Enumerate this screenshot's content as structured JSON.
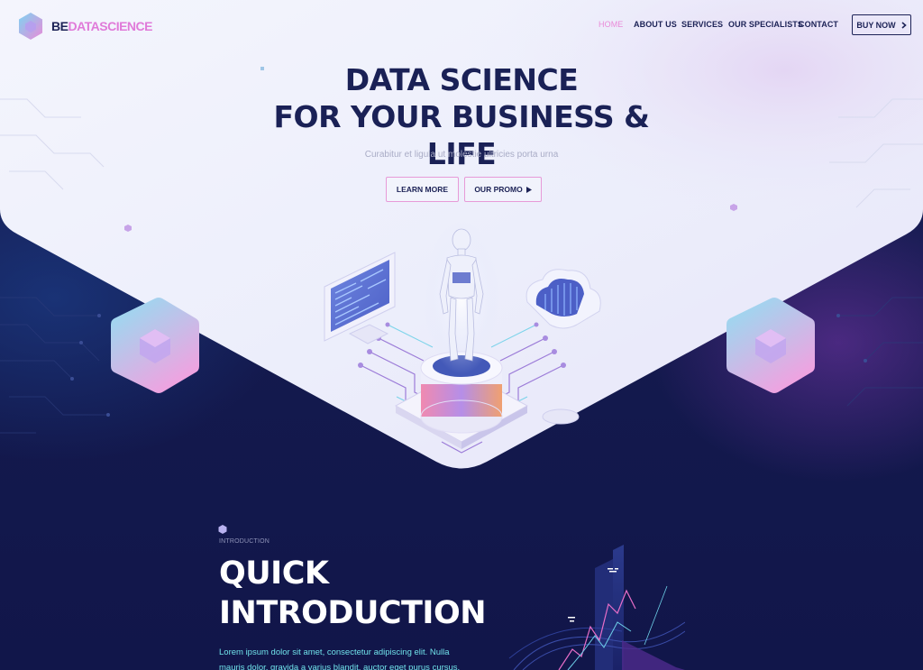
{
  "brand": {
    "logo_prefix": "BE",
    "logo_suffix": "DATASCIENCE",
    "primary_color": "#1c2256",
    "accent_color": "#e98ad8",
    "dark_bg_color": "#121846",
    "highlight_text_color": "#6fe0e8"
  },
  "nav": {
    "items": [
      {
        "label": "HOME",
        "active": true
      },
      {
        "label": "ABOUT US",
        "active": false
      },
      {
        "label": "SERVICES",
        "active": false
      },
      {
        "label": "OUR SPECIALISTS",
        "active": false
      },
      {
        "label": "CONTACT",
        "active": false
      }
    ],
    "cta": {
      "label": "BUY NOW",
      "icon": "chevron-right-icon"
    }
  },
  "hero": {
    "title_line1": "DATA SCIENCE",
    "title_line2": "FOR YOUR BUSINESS & LIFE",
    "subtitle": "Curabitur et ligula ut molestie ultricies porta urna",
    "buttons": [
      {
        "label": "LEARN MORE"
      },
      {
        "label": "OUR PROMO",
        "icon": "play-icon"
      }
    ]
  },
  "intro": {
    "eyebrow": "INTRODUCTION",
    "title_line1": "QUICK",
    "title_line2": "INTRODUCTION",
    "text": "Lorem ipsum dolor sit amet, consectetur adipiscing elit. Nulla mauris dolor, gravida a varius blandit, auctor eget purus cursus."
  }
}
